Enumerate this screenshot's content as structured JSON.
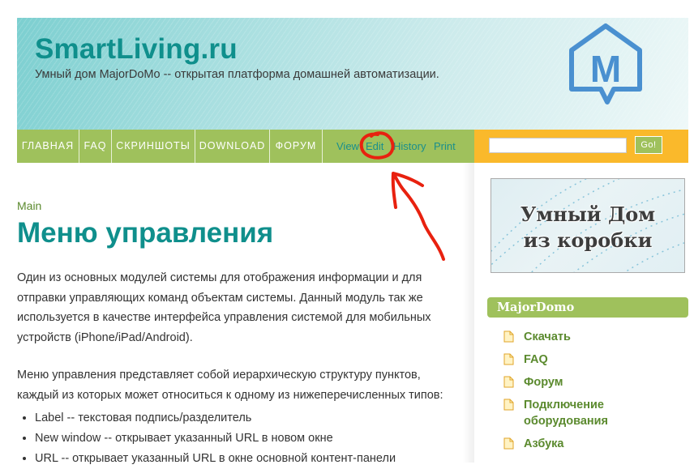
{
  "header": {
    "title": "SmartLiving.ru",
    "slogan": "Умный дом MajorDoMo -- открытая платформа домашней автоматизации.",
    "logo_letter": "M"
  },
  "nav": {
    "items": [
      {
        "label": "ГЛАВНАЯ"
      },
      {
        "label": "FAQ"
      },
      {
        "label": "СКРИНШОТЫ"
      },
      {
        "label": "DOWNLOAD"
      },
      {
        "label": "ФОРУМ"
      }
    ],
    "actions": [
      {
        "label": "View"
      },
      {
        "label": "Edit"
      },
      {
        "label": "History"
      },
      {
        "label": "Print"
      }
    ]
  },
  "search": {
    "value": "",
    "button_label": "Go!"
  },
  "content": {
    "breadcrumb": "Main",
    "title": "Меню управления",
    "para1": "Один из основных модулей системы для отображения информации и для отправки управляющих команд объектам системы. Данный модуль так же используется в качестве интерфейса управления системой для мобильных устройств (iPhone/iPad/Android).",
    "para2": "Меню управления представляет собой иерархическую структуру пунктов, каждый из которых может относиться к одному из нижеперечисленных типов:",
    "types": [
      "Label -- текстовая подпись/разделитель",
      "New window -- открывает указанный URL в новом окне",
      "URL -- открывает указанный URL в окне основной контент-панели"
    ]
  },
  "sidebar": {
    "banner": {
      "line1": "Умный Дом",
      "line2": "из коробки"
    },
    "block_title": "MajorDomo",
    "items": [
      {
        "label": "Скачать"
      },
      {
        "label": "FAQ"
      },
      {
        "label": "Форум"
      },
      {
        "label": "Подключение оборудования"
      },
      {
        "label": "Азбука"
      }
    ]
  },
  "colors": {
    "teal": "#0f8f8c",
    "nav_green": "#9fc15c",
    "search_orange": "#fab92b",
    "annotation_red": "#e8210f",
    "link_green": "#5b8a2e"
  }
}
